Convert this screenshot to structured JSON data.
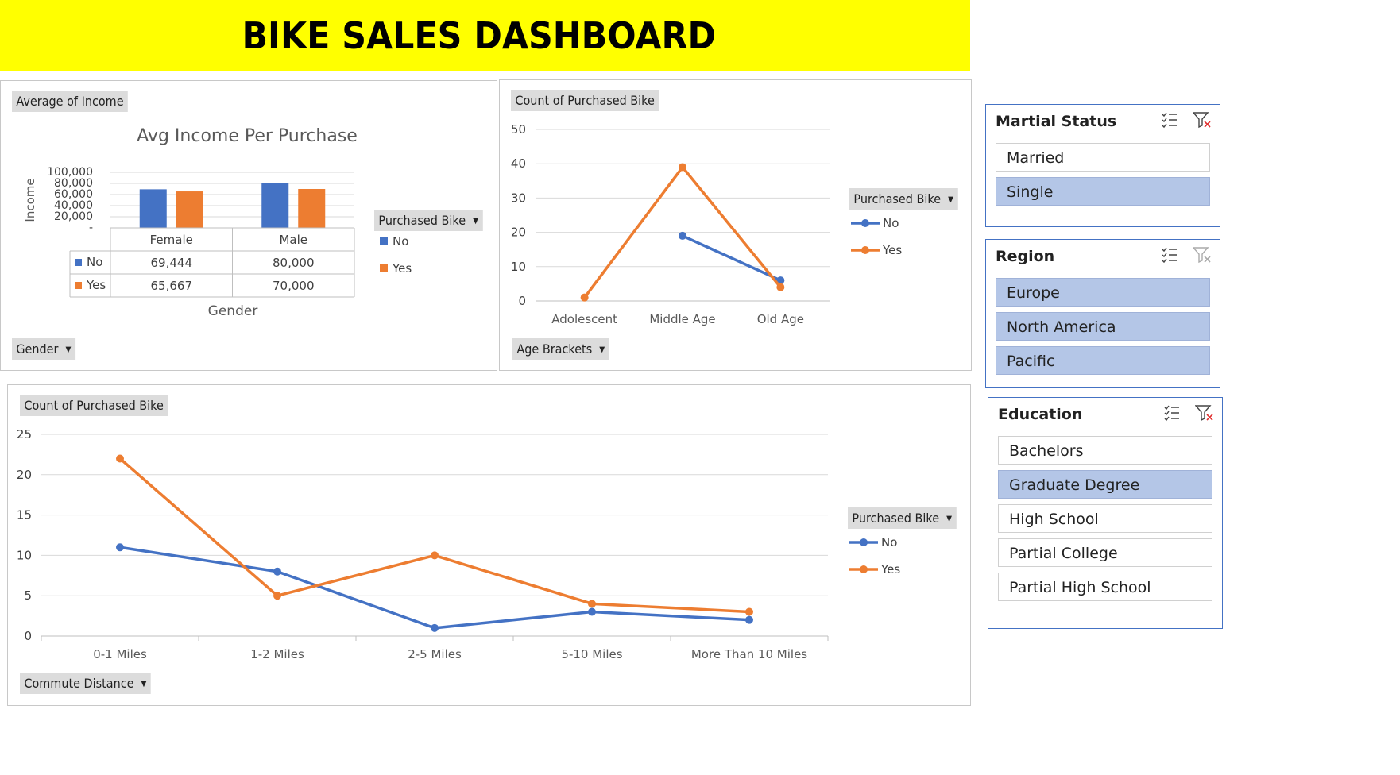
{
  "banner": {
    "title": "BIKE SALES DASHBOARD"
  },
  "colors": {
    "no": "#4472c4",
    "yes": "#ed7d31",
    "banner": "#ffff00",
    "slicer_selected": "#b4c6e7"
  },
  "income_panel": {
    "value_field": "Average of Income",
    "axis_field": "Gender",
    "legend_field": "Purchased Bike",
    "legend_items": [
      "No",
      "Yes"
    ]
  },
  "age_panel": {
    "value_field": "Count of Purchased Bike",
    "axis_field": "Age Brackets",
    "legend_field": "Purchased Bike",
    "legend_items": [
      "No",
      "Yes"
    ]
  },
  "commute_panel": {
    "value_field": "Count of Purchased Bike",
    "axis_field": "Commute Distance",
    "legend_field": "Purchased Bike",
    "legend_items": [
      "No",
      "Yes"
    ]
  },
  "chart_data": [
    {
      "type": "bar",
      "title": "Avg Income Per Purchase",
      "xlabel": "Gender",
      "ylabel": "Income",
      "categories": [
        "Female",
        "Male"
      ],
      "series": [
        {
          "name": "No",
          "values": [
            69444,
            80000
          ],
          "labels": [
            "69,444",
            "80,000"
          ]
        },
        {
          "name": "Yes",
          "values": [
            65667,
            70000
          ],
          "labels": [
            "65,667",
            "70,000"
          ]
        }
      ],
      "ylim": [
        0,
        100000
      ],
      "yticks": [
        "-",
        "20,000",
        "40,000",
        "60,000",
        "80,000",
        "100,000"
      ],
      "grid": true,
      "data_table": true
    },
    {
      "type": "line",
      "title": "",
      "categories": [
        "Adolescent",
        "Middle Age",
        "Old Age"
      ],
      "series": [
        {
          "name": "No",
          "values": [
            null,
            19,
            6
          ]
        },
        {
          "name": "Yes",
          "values": [
            1,
            39,
            4
          ]
        }
      ],
      "ylim": [
        0,
        50
      ],
      "yticks": [
        "0",
        "10",
        "20",
        "30",
        "40",
        "50"
      ],
      "grid": true,
      "legend": "right"
    },
    {
      "type": "line",
      "title": "",
      "categories": [
        "0-1 Miles",
        "1-2 Miles",
        "2-5 Miles",
        "5-10 Miles",
        "More Than 10 Miles"
      ],
      "series": [
        {
          "name": "No",
          "values": [
            11,
            8,
            1,
            3,
            2
          ]
        },
        {
          "name": "Yes",
          "values": [
            22,
            5,
            10,
            4,
            3
          ]
        }
      ],
      "ylim": [
        0,
        25
      ],
      "yticks": [
        "0",
        "5",
        "10",
        "15",
        "20",
        "25"
      ],
      "grid": true,
      "legend": "right"
    }
  ],
  "slicers": {
    "marital": {
      "title": "Martial Status",
      "items": [
        {
          "label": "Married",
          "selected": false
        },
        {
          "label": "Single",
          "selected": true
        }
      ]
    },
    "region": {
      "title": "Region",
      "items": [
        {
          "label": "Europe",
          "selected": true
        },
        {
          "label": "North America",
          "selected": true
        },
        {
          "label": "Pacific",
          "selected": true
        }
      ]
    },
    "education": {
      "title": "Education",
      "items": [
        {
          "label": "Bachelors",
          "selected": false
        },
        {
          "label": "Graduate Degree",
          "selected": true
        },
        {
          "label": "High School",
          "selected": false
        },
        {
          "label": "Partial College",
          "selected": false
        },
        {
          "label": "Partial High School",
          "selected": false
        }
      ]
    }
  }
}
